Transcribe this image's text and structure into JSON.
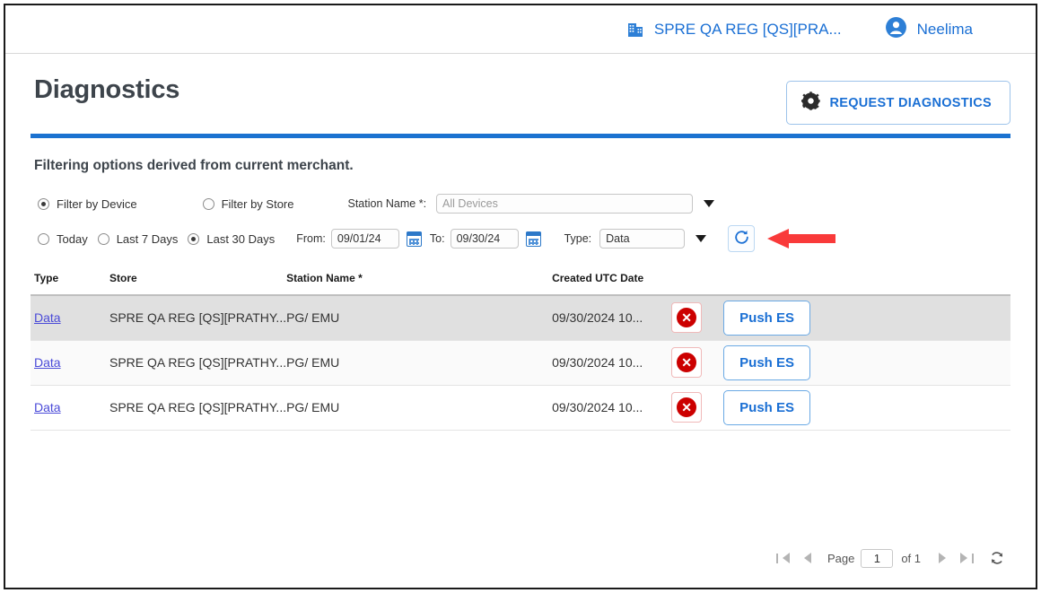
{
  "topbar": {
    "merchant": "SPRE QA REG [QS][PRA...",
    "merchant_icon": "building-icon",
    "user": "Neelima",
    "user_icon": "person-circle-icon"
  },
  "header": {
    "title": "Diagnostics",
    "request_button": "REQUEST DIAGNOSTICS",
    "request_icon": "gear-icon",
    "accent_color": "#1b72d0"
  },
  "filters": {
    "note": "Filtering options derived from current merchant.",
    "device_radio": "Filter by Device",
    "store_radio": "Filter by Store",
    "selected_scope": "Filter by Device",
    "station_label": "Station Name *:",
    "station_value": "",
    "station_placeholder": "All Devices",
    "today_radio": "Today",
    "last7_radio": "Last 7 Days",
    "last30_radio": "Last 30 Days",
    "selected_range": "Last 30 Days",
    "from_label": "From:",
    "from_value": "09/01/24",
    "to_label": "To:",
    "to_value": "09/30/24",
    "type_label": "Type:",
    "type_value": "Data",
    "refresh_icon": "refresh-icon",
    "calendar_icon": "calendar-icon"
  },
  "table": {
    "columns": [
      "Type",
      "Store",
      "Station Name *",
      "Created UTC Date"
    ],
    "rows": [
      {
        "type": "Data",
        "store": "SPRE QA REG [QS][PRATHY...",
        "station": "PG/ EMU",
        "created": "09/30/2024 10...",
        "delete_icon": "delete-circle-icon",
        "push_label": "Push ES"
      },
      {
        "type": "Data",
        "store": "SPRE QA REG [QS][PRATHY...",
        "station": "PG/ EMU",
        "created": "09/30/2024 10...",
        "delete_icon": "delete-circle-icon",
        "push_label": "Push ES"
      },
      {
        "type": "Data",
        "store": "SPRE QA REG [QS][PRATHY...",
        "station": "PG/ EMU",
        "created": "09/30/2024 10...",
        "delete_icon": "delete-circle-icon",
        "push_label": "Push ES"
      }
    ]
  },
  "pager": {
    "first_icon": "first-page-icon",
    "prev_icon": "previous-page-icon",
    "page_label": "Page",
    "page_value": "1",
    "of_label": "of 1",
    "next_icon": "next-page-icon",
    "last_icon": "last-page-icon",
    "refresh_icon": "refresh-icon"
  },
  "annotation": {
    "arrow_color": "#f93a3a"
  }
}
